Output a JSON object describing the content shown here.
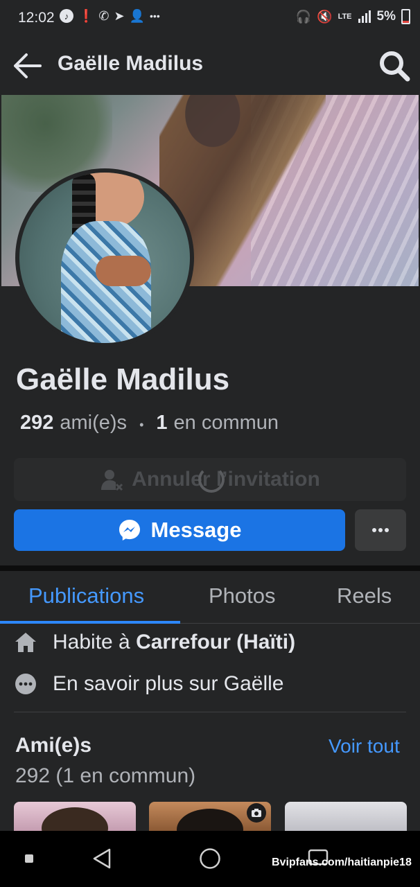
{
  "status_bar": {
    "time": "12:02",
    "battery_percent": "5%",
    "left_icons": [
      "tiktok-icon",
      "alert-icon",
      "whatsapp-icon",
      "telegram-icon",
      "add-person-icon",
      "more-notifications-icon"
    ],
    "right_icons": [
      "headset-icon",
      "mute-icon",
      "lte-icon",
      "signal-icon",
      "battery-icon"
    ]
  },
  "app_bar": {
    "title": "Gaëlle Madilus"
  },
  "profile": {
    "name": "Gaëlle Madilus",
    "friends_count": "292",
    "friends_label": "ami(e)s",
    "mutual_count": "1",
    "mutual_label": "en commun"
  },
  "actions": {
    "cancel_invite_label": "Annuler l’invitation",
    "message_label": "Message",
    "more_label": "···"
  },
  "tabs": [
    {
      "label": "Publications",
      "active": true
    },
    {
      "label": "Photos",
      "active": false
    },
    {
      "label": "Reels",
      "active": false
    }
  ],
  "about": {
    "lives_prefix": "Habite à ",
    "lives_place": "Carrefour (Haïti)",
    "more_info": "En savoir plus sur Gaëlle"
  },
  "friends": {
    "title": "Ami(e)s",
    "see_all": "Voir tout",
    "count_text": "292 (1 en commun)"
  },
  "watermark": "Bvipfans.com/haitianpie18",
  "colors": {
    "background": "#242526",
    "accent_blue": "#1b74e4",
    "link_blue": "#4599ff",
    "text_primary": "#e4e6eb",
    "text_secondary": "#b0b3b8"
  }
}
